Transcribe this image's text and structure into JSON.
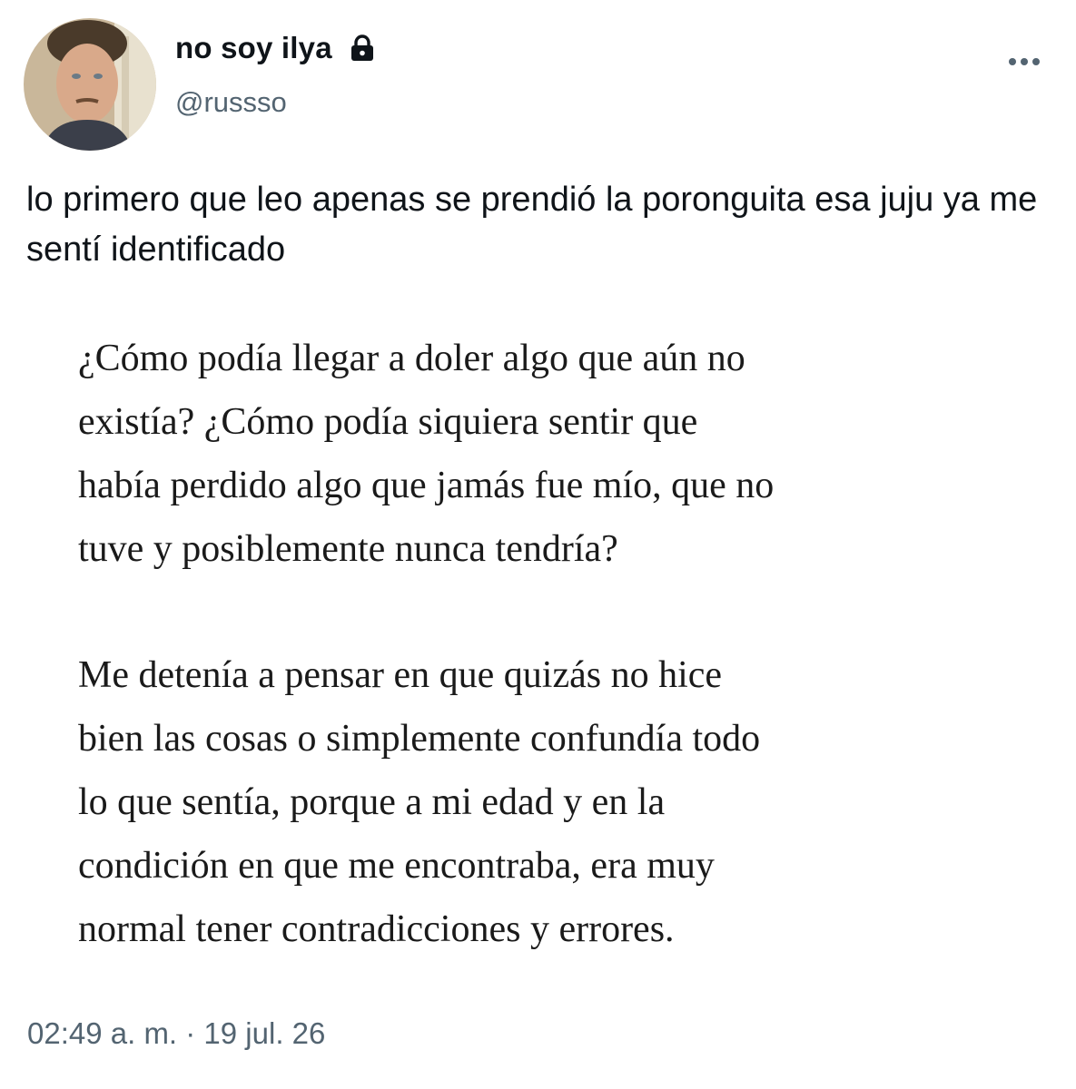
{
  "user": {
    "display_name": "no soy ilya",
    "handle": "@russso",
    "lock_icon": "lock-icon",
    "avatar_icon": "avatar-photo"
  },
  "menu": {
    "more_icon": "more-horizontal-icon"
  },
  "tweet": {
    "text": "lo primero que leo apenas se prendió la poronguita esa juju ya me sentí identificado"
  },
  "image_text": {
    "paragraph1": [
      "¿Cómo podía llegar a doler algo que aún no",
      "existía? ¿Cómo podía siquiera sentir que",
      "había perdido algo que jamás fue mío, que no",
      "tuve y posiblemente nunca tendría?"
    ],
    "paragraph2": [
      "Me detenía a pensar en que quizás no hice",
      "bien las cosas o simplemente confundía todo",
      "lo que sentía, porque a mi edad y en la",
      "condición en que me encontraba, era muy",
      "normal tener contradicciones y errores."
    ]
  },
  "timestamp": "02:49 a. m. · 19 jul. 26",
  "colors": {
    "text": "#0f1419",
    "secondary": "#536471",
    "background": "#ffffff"
  }
}
